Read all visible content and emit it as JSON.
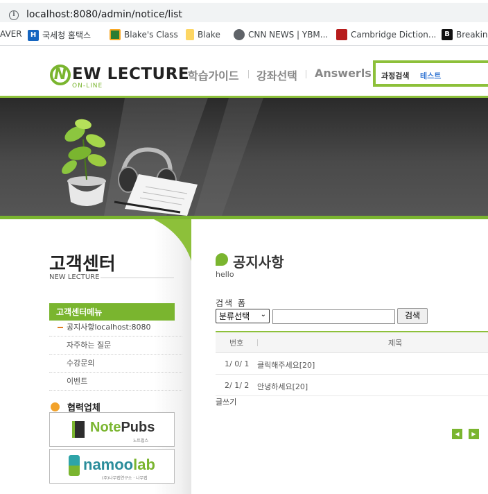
{
  "browser": {
    "url": "localhost:8080/admin/notice/list",
    "bookmarks": [
      {
        "label": "AVER"
      },
      {
        "label": "국세청 홈택스"
      },
      {
        "label": "Blake's Class"
      },
      {
        "label": "Blake"
      },
      {
        "label": "CNN NEWS | YBM..."
      },
      {
        "label": "Cambridge Diction..."
      },
      {
        "label": "Breaking"
      }
    ]
  },
  "header": {
    "logo_letter": "N",
    "logo_text": "EW LECTURE",
    "logo_sub": "ON-LINE",
    "nav": [
      "학습가이드",
      "강좌선택",
      "Answerls"
    ],
    "search_label": "과정검색",
    "search_value": "테스트"
  },
  "sidebar": {
    "title": "고객센터",
    "subtitle": "NEW LECTURE",
    "menu_head": "고객센터메뉴",
    "items": [
      "공지사항localhost:8080",
      "자주하는 질문",
      "수강문의",
      "이벤트"
    ],
    "partners_title": "협력업체",
    "partners": [
      {
        "name_a": "Note",
        "name_b": "Pubs",
        "sub": "노트펍스"
      },
      {
        "name_a": "namoo",
        "name_b": "lab",
        "sub": "(주)나무랩연구소 · 나무랩"
      }
    ]
  },
  "main": {
    "title": "공지사항",
    "subtitle": "hello",
    "search_form_label": "검색 폼",
    "select_value": "분류선택",
    "search_button": "검색",
    "columns": [
      "번호",
      "제목"
    ],
    "rows": [
      {
        "num": "1/ 0/ 1",
        "title": "클릭해주세요[20]"
      },
      {
        "num": "2/ 1/ 2",
        "title": "안녕하세요[20]"
      }
    ],
    "write_link": "글쓰기",
    "pager_prev": "◀",
    "pager_next": "▶"
  },
  "colors": {
    "accent": "#7ab52f",
    "accent_light": "#8dc03a",
    "orange": "#e07b20"
  }
}
